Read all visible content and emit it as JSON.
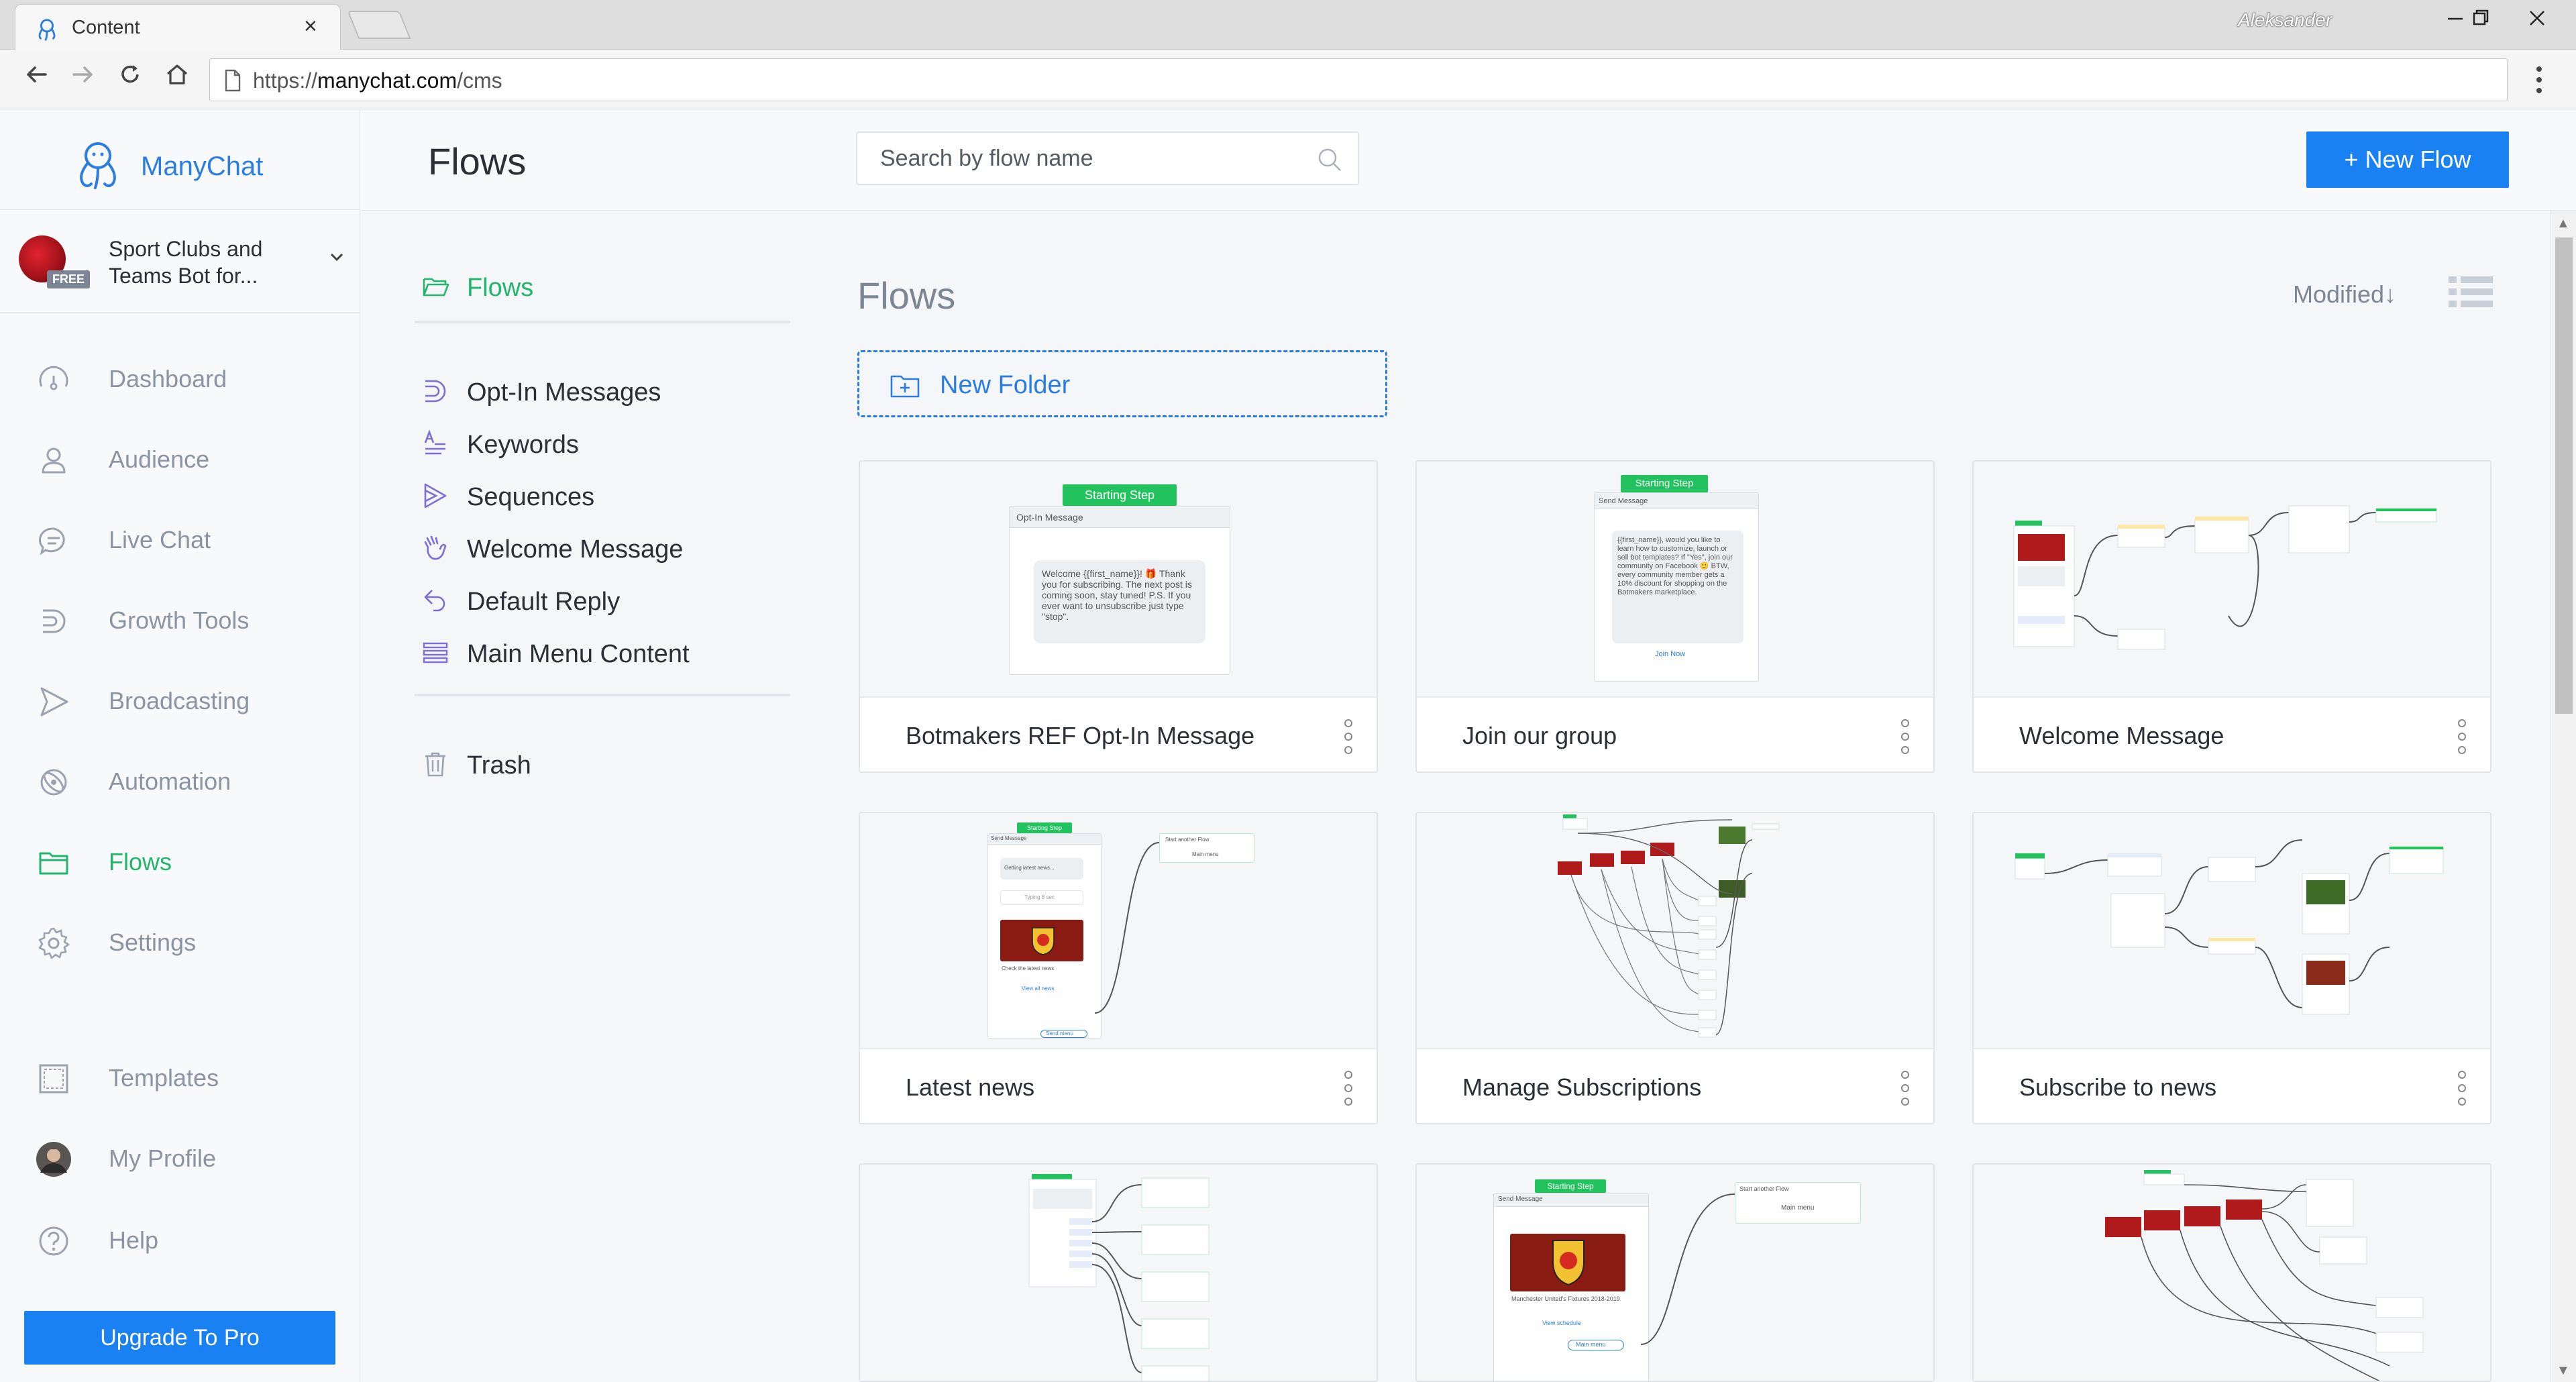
{
  "browser": {
    "tab_title": "Content",
    "close_glyph": "×",
    "url_protocol": "https://",
    "url_host": "manychat.com",
    "url_path": "/cms",
    "user_name": "Aleksander",
    "icons": [
      "manychat-tab-icon",
      "back-arrow-icon",
      "forward-arrow-icon",
      "reload-icon",
      "home-icon",
      "page-info-icon",
      "browser-menu-icon",
      "minimize-icon",
      "restore-icon",
      "close-window-icon"
    ]
  },
  "brand": {
    "name": "ManyChat",
    "accent": "#2a7de1",
    "green": "#21b66c",
    "button_blue": "#1a81f3"
  },
  "account": {
    "name": "Sport Clubs and Teams Bot for...",
    "badge": "FREE"
  },
  "nav": {
    "items": [
      {
        "label": "Dashboard",
        "icon": "gauge-icon"
      },
      {
        "label": "Audience",
        "icon": "person-icon"
      },
      {
        "label": "Live Chat",
        "icon": "chat-bubble-icon"
      },
      {
        "label": "Growth Tools",
        "icon": "growth-tools-icon"
      },
      {
        "label": "Broadcasting",
        "icon": "send-icon"
      },
      {
        "label": "Automation",
        "icon": "automation-icon"
      },
      {
        "label": "Flows",
        "icon": "folder-icon",
        "active": true
      },
      {
        "label": "Settings",
        "icon": "gear-icon"
      },
      {
        "label": "Templates",
        "icon": "templates-icon"
      },
      {
        "label": "My Profile",
        "icon": "profile-avatar"
      },
      {
        "label": "Help",
        "icon": "help-icon"
      }
    ],
    "upgrade_label": "Upgrade To Pro"
  },
  "header": {
    "title": "Flows",
    "search_placeholder": "Search by flow name",
    "new_flow_label": "+ New Flow"
  },
  "folders": {
    "items": [
      {
        "label": "Flows",
        "icon": "open-folder-icon",
        "active": true
      },
      {
        "label": "Opt-In Messages",
        "icon": "opt-in-icon"
      },
      {
        "label": "Keywords",
        "icon": "keywords-icon"
      },
      {
        "label": "Sequences",
        "icon": "sequences-icon"
      },
      {
        "label": "Welcome Message",
        "icon": "wave-hand-icon"
      },
      {
        "label": "Default Reply",
        "icon": "reply-arrow-icon"
      },
      {
        "label": "Main Menu Content",
        "icon": "menu-lines-icon"
      },
      {
        "label": "Trash",
        "icon": "trash-icon"
      }
    ]
  },
  "content": {
    "title": "Flows",
    "sort_label": "Modified",
    "sort_arrow": "↓",
    "new_folder_label": "New Folder"
  },
  "preview_text": {
    "starting_step": "Starting Step",
    "optin_header": "Opt-In Message",
    "optin_body": "Welcome {{first_name}}! 🎁 Thank you for subscribing. The next post is coming soon, stay tuned! P.S. If you ever want to unsubscribe just type \"stop\".",
    "send_message": "Send Message",
    "join_body": "{{first_name}}, would you like to learn how to customize, launch or sell bot templates? If \"Yes\", join our community on Facebook 🙂 BTW, every community member gets a 10% discount for shopping on the Botmakers marketplace.",
    "join_button": "Join Now",
    "latest_news_text": "Getting latest news...",
    "latest_news_placeholder": "Typing 8 sec",
    "latest_news_caption": "Check the latest news",
    "latest_news_button": "View all news",
    "latest_news_link": "Send menu",
    "start_another_flow": "Start another Flow",
    "main_menu": "Main menu",
    "fixtures_caption": "Manchester United's Fixtures 2018-2019",
    "fixtures_button": "View schedule",
    "main_menu_button": "Main menu"
  },
  "cards": [
    {
      "name": "Botmakers REF Opt-In Message",
      "preview": "optin"
    },
    {
      "name": "Join our group",
      "preview": "join"
    },
    {
      "name": "Welcome Message",
      "preview": "diagram-a"
    },
    {
      "name": "Latest news",
      "preview": "latest"
    },
    {
      "name": "Manage Subscriptions",
      "preview": "diagram-b"
    },
    {
      "name": "Subscribe to news",
      "preview": "diagram-c"
    },
    {
      "name": "",
      "preview": "diagram-d"
    },
    {
      "name": "",
      "preview": "fixtures"
    },
    {
      "name": "",
      "preview": "diagram-e"
    }
  ]
}
